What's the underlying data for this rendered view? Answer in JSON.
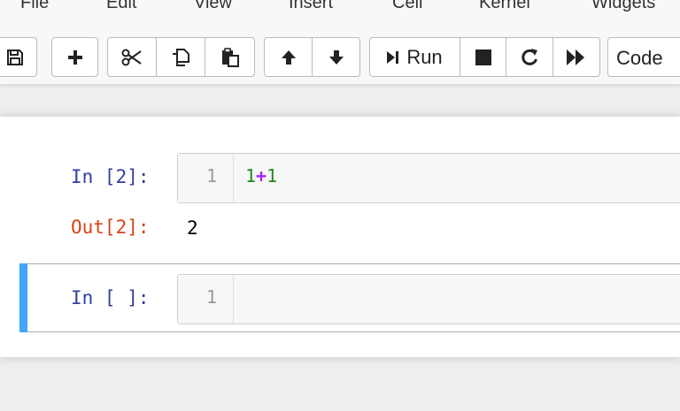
{
  "menubar": {
    "items": [
      "File",
      "Edit",
      "View",
      "Insert",
      "Cell",
      "Kernel",
      "Widgets"
    ]
  },
  "toolbar": {
    "save_icon": "floppy-disk-icon",
    "add_icon": "plus-icon",
    "cut_icon": "scissors-icon",
    "copy_icon": "copy-icon",
    "paste_icon": "clipboard-icon",
    "move_up_icon": "arrow-up-icon",
    "move_down_icon": "arrow-down-icon",
    "run_label": "Run",
    "stop_icon": "stop-icon",
    "restart_icon": "restart-icon",
    "fast_forward_icon": "fast-forward-icon",
    "cell_type": "Code"
  },
  "cells": [
    {
      "in_prompt": "In [2]:",
      "line_number": "1",
      "code_tokens": [
        "1",
        "+",
        "1"
      ],
      "out_prompt": "Out[2]:",
      "output": "2"
    },
    {
      "in_prompt": "In [ ]:",
      "line_number": "1",
      "code": ""
    }
  ],
  "colors": {
    "selected_bar": "#42a5f5",
    "in_prompt": "#303f9f",
    "out_prompt": "#d84315",
    "number_token": "#228822",
    "operator_token": "#aa22ff"
  }
}
